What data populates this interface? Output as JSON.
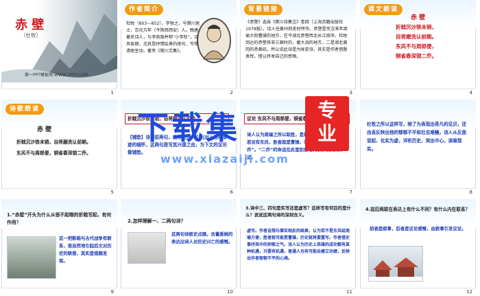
{
  "slides": [
    {
      "num": "1",
      "title": "赤 壁",
      "subtitle": "（杜牧）",
      "watermark": "第一PPT模板网-WWW.1PPT.COM"
    },
    {
      "num": "2",
      "tag": "作者简介",
      "body": "杜牧（803—852），字牧之，号樊川居士，京兆万年（今陕西西安）人。晚唐著名诗人，与李商隐并称“小李杜”。诗风俊朗，尤其是抒情绘景的绝句，写得清丽生动。著有《樊川文集》。"
    },
    {
      "num": "3",
      "tag": "背景链接",
      "body": "《赤壁》选自《樊川诗集注》卷四（上海古籍出版社1978版）。诗人任黄州刺史时所作。赤壁是东汉末年周瑜大败曹操的地方，在今湖北赤壁西北长江南岸。杜牧到达的赤壁其非三国时的，著大战的地方，二是湖北黄冈的赤鼻矶。所以说此诗是为咏史诗，其实是作者借题发挥，借以抒发自己的感慨。"
    },
    {
      "num": "4",
      "tag": "课文朗读",
      "title": "赤 壁",
      "lines": [
        "折戟沉沙铁未销，",
        "自将磨洗认前朝。",
        "东风不与周郎便，",
        "铜雀春深锁二乔。"
      ]
    },
    {
      "num": "5",
      "tag": "诗歌朗读",
      "title": "赤 壁",
      "lines": [
        "折戟沉沙铁未销，自将磨洗认前朝。",
        "东风不与周郎便，铜雀春深锁二乔。"
      ]
    },
    {
      "num": "6",
      "tag": "铺垫",
      "line1": "折戟沉沙铁未销，自将磨洗认前朝。",
      "line2": "【铺垫】诗的前两句，由物起兴，引出对人物和事迹的缅怀，这两句是写其兴感之由，为下文的议论做铺垫。"
    },
    {
      "num": "7",
      "tag": "议论",
      "line1": "议论 东风不与周郎便，铜雀春深锁二乔。",
      "line2": "诗人认为周瑜之所以取胜，是赖上天赐给的东风。倘若没有东风，胜者就是曹操，而送“铜雀春深锁二乔”。“二乔”的命运在此里别意地代表了东吴的命运。"
    },
    {
      "num": "8",
      "body": "杜牧之所以这样写，除了为表现出奇凡的见识，还由衷反映出他的郁郁不平和壮志难酬。诗人从反面说起，化实为虚，详析历史，突出中心，讽喻现实。"
    },
    {
      "num": "9",
      "question": "1.“赤壁”开头为什么从很不起眼的折戟写起，有何作用？",
      "answer": "这一把断戟与古代战争有联系，很自然地引起后文对历史的联想，其实是借题发挥。"
    },
    {
      "num": "10",
      "question": "2.怎样理解一、二两句诗？",
      "answer": "这两句诗叙史点题，含蓄委婉的表达出诗人对历史兴亡的感慨。"
    },
    {
      "num": "11",
      "question": "3.诗中三、四句是实写还是虚写？这样写有何目的是什么？说说这两句诗的深刻含义。",
      "answer": "虚写。作者设想与事实相反的结果，认为若不是东风给周瑜方便，胜者就可能是曹操，历史就将要重写。作者借史事抒其中的抑郁之气。诗人认为历史上英雄的成功都有某种机遇，只要有机遇，普通人也有可能会建立功绩，反映出作者郁郁不平的心境。"
    },
    {
      "num": "12",
      "question": "4.前后两联在表达上有什么不同？有什么内在联系？",
      "answer": "前者是叙事，后者是议论感慨，由叙事引发议论。"
    }
  ],
  "overlay": {
    "big_text": "下载集",
    "badge_line1": "专",
    "badge_line2": "业",
    "url": "www.xiazaiji.com"
  }
}
